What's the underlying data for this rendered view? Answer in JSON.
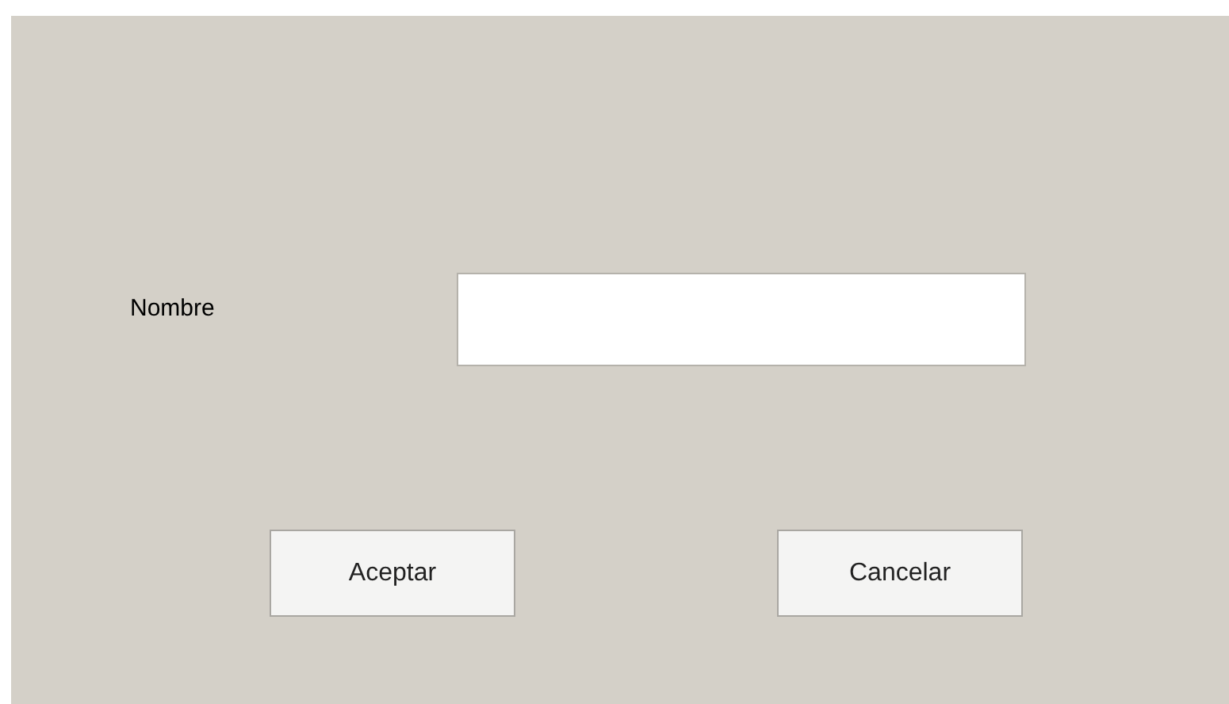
{
  "form": {
    "label": "Nombre"
  },
  "buttons": [
    "Aceptar",
    "Cancelar"
  ]
}
